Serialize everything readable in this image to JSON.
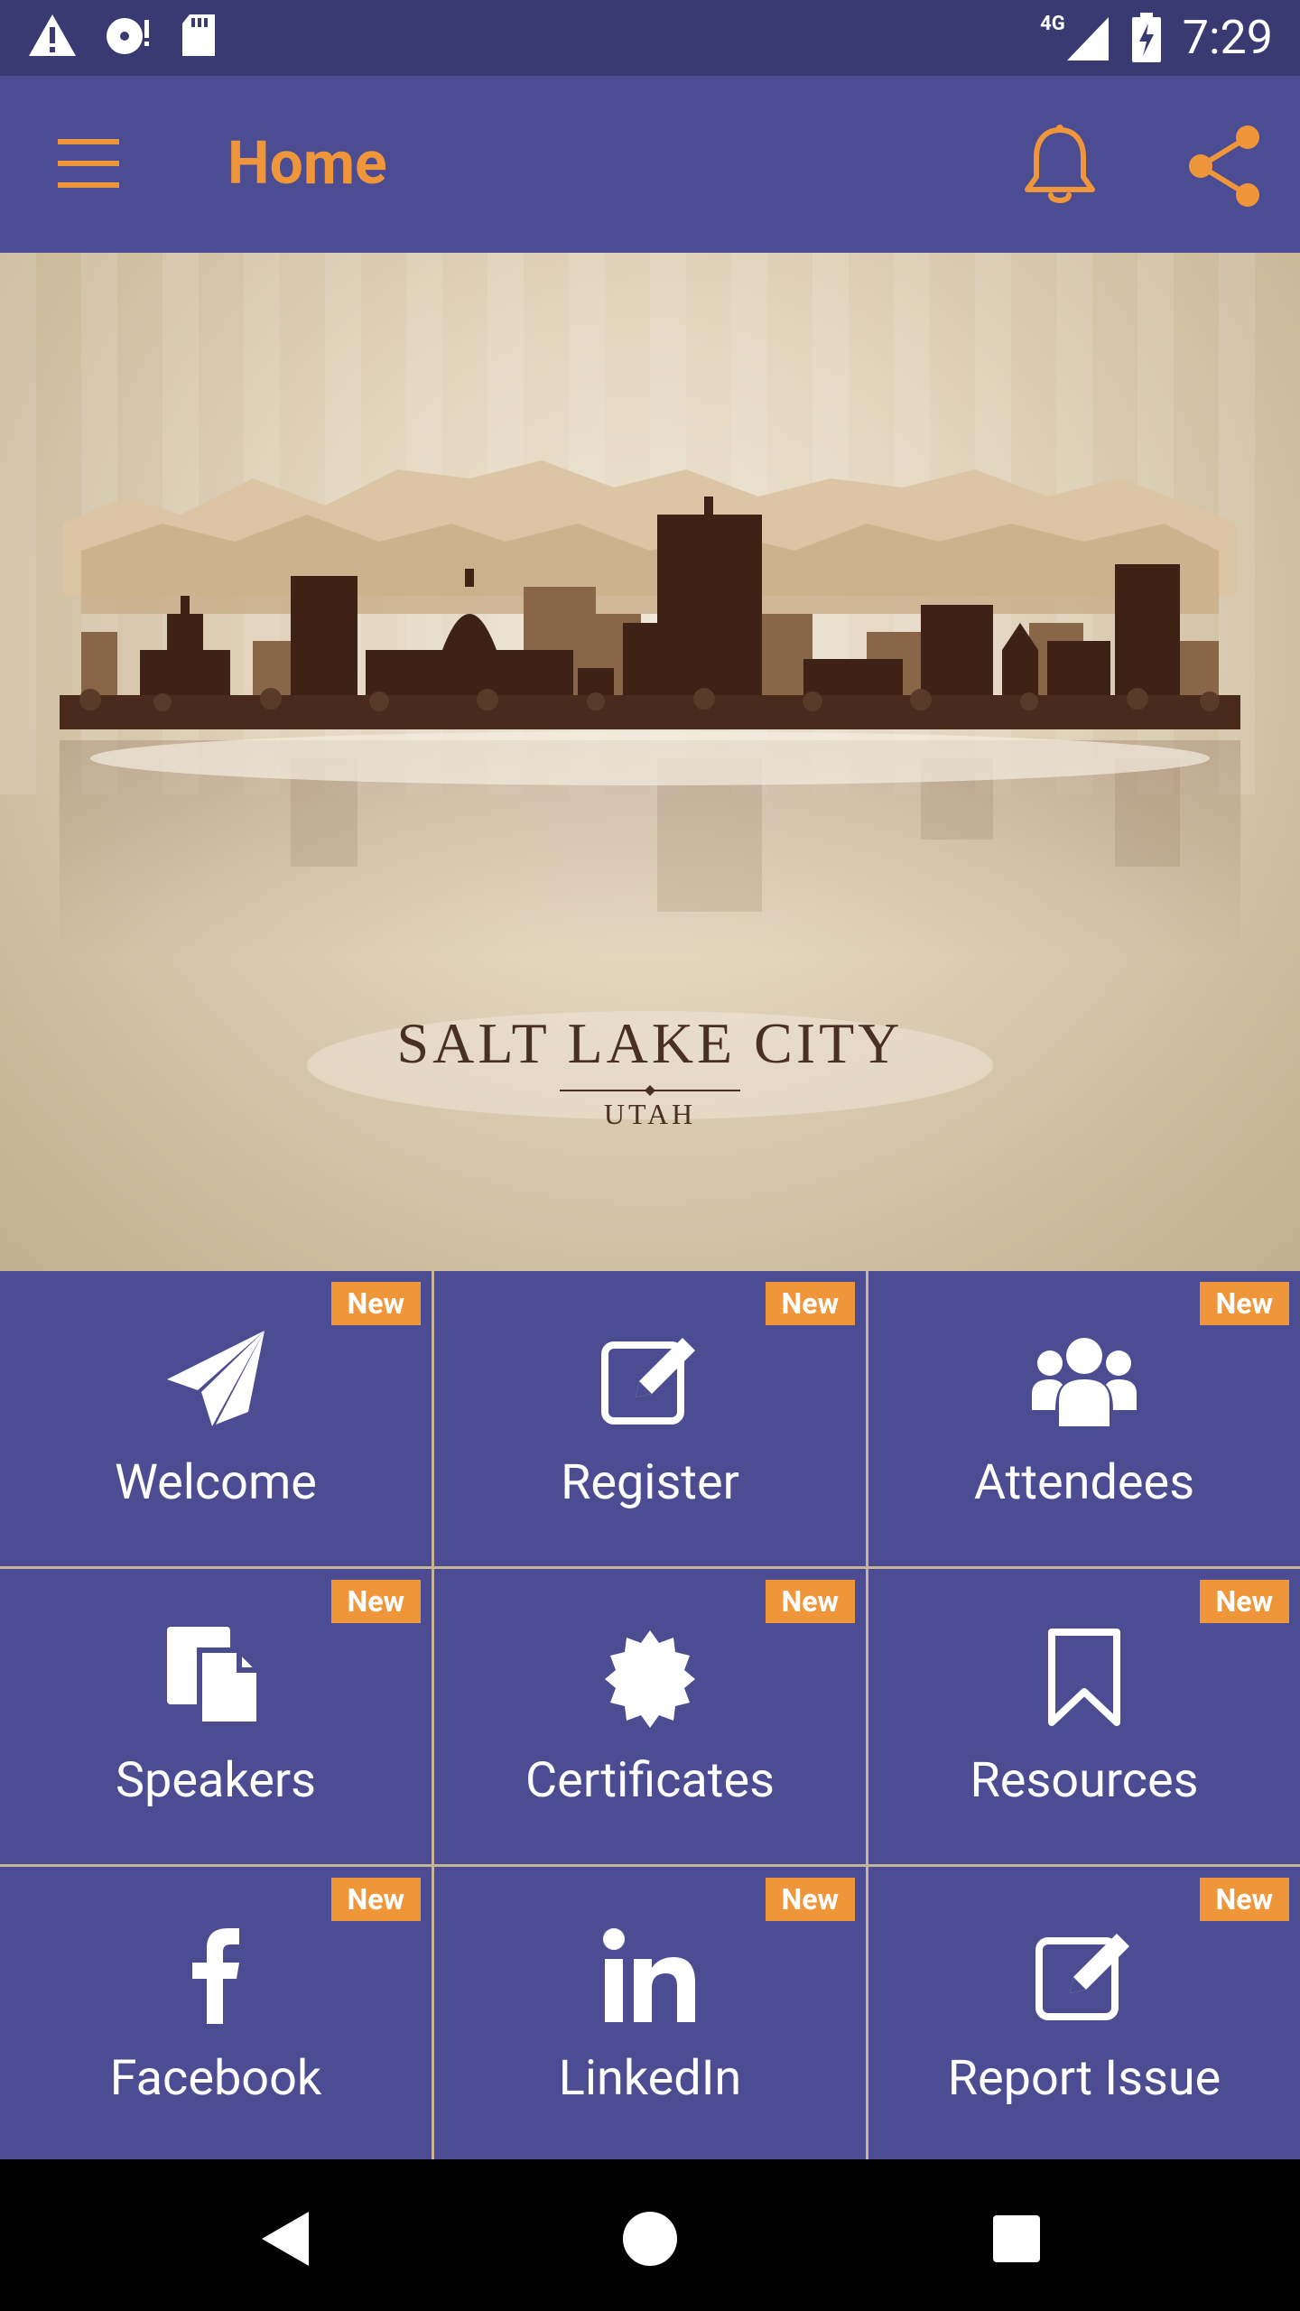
{
  "status_bar": {
    "time": "7:29",
    "network": "4G",
    "icons": [
      "alert-icon",
      "disc-icon",
      "sdcard-icon",
      "signal-icon",
      "battery-charging-icon"
    ]
  },
  "app_bar": {
    "title": "Home",
    "menu_icon": "hamburger-menu-icon",
    "notifications_icon": "bell-icon",
    "share_icon": "share-icon"
  },
  "hero": {
    "city": "SALT LAKE CITY",
    "state": "UTAH"
  },
  "tiles": [
    {
      "label": "Welcome",
      "badge": "New",
      "icon": "paper-plane-icon"
    },
    {
      "label": "Register",
      "badge": "New",
      "icon": "edit-icon"
    },
    {
      "label": "Attendees",
      "badge": "New",
      "icon": "users-icon"
    },
    {
      "label": "Speakers",
      "badge": "New",
      "icon": "documents-icon"
    },
    {
      "label": "Certificates",
      "badge": "New",
      "icon": "certificate-icon"
    },
    {
      "label": "Resources",
      "badge": "New",
      "icon": "bookmark-icon"
    },
    {
      "label": "Facebook",
      "badge": "New",
      "icon": "facebook-icon"
    },
    {
      "label": "LinkedIn",
      "badge": "New",
      "icon": "linkedin-icon"
    },
    {
      "label": "Report Issue",
      "badge": "New",
      "icon": "edit-icon"
    }
  ],
  "colors": {
    "primary": "#4b4c92",
    "status_bar": "#3a3a72",
    "accent": "#f0963a",
    "divider": "#c4b59a"
  },
  "nav_bar": {
    "icons": [
      "back-icon",
      "home-icon",
      "recents-icon"
    ]
  }
}
